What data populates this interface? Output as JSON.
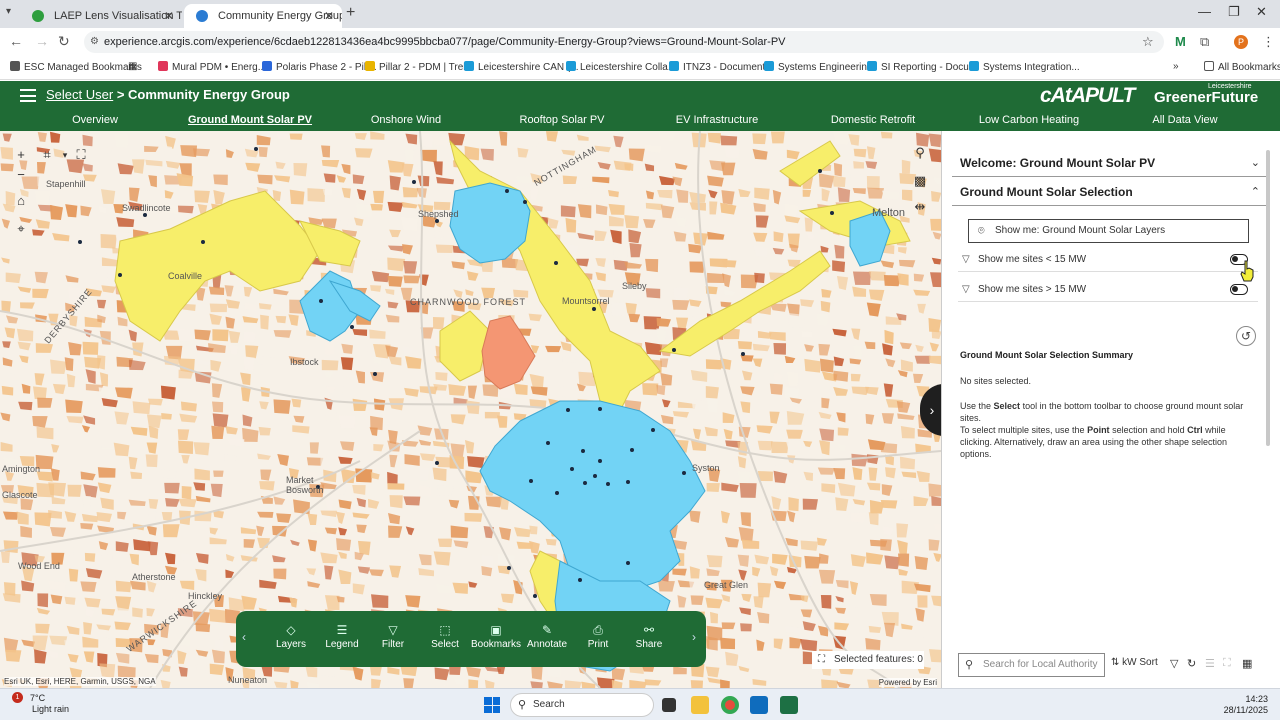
{
  "browser": {
    "tabs": [
      {
        "title": "LAEP Lens Visualisation Tool | G",
        "favicon_color": "#2e9e3e"
      },
      {
        "title": "Community Energy Group | Lei",
        "favicon_color": "#2b7cd3"
      }
    ],
    "url": "experience.arcgis.com/experience/6cdaeb122813436ea4bc9995bbcba077/page/Community-Energy-Group?views=Ground-Mount-Solar-PV",
    "bookmarks": [
      {
        "label": "ESC Managed Bookmarks",
        "color": "#555555"
      },
      {
        "label": "Mural PDM • Energ...",
        "color": "#e0365a"
      },
      {
        "label": "Polaris Phase 2 - Pill...",
        "color": "#2b67d9"
      },
      {
        "label": "Pillar 2 - PDM | Trello",
        "color": "#e8b400"
      },
      {
        "label": "Leicestershire CAN (...",
        "color": "#1b9bd7"
      },
      {
        "label": "Leicestershire Colla...",
        "color": "#1b9bd7"
      },
      {
        "label": "ITNZ3 - Documents",
        "color": "#1b9bd7"
      },
      {
        "label": "Systems Engineerin...",
        "color": "#1b9bd7"
      },
      {
        "label": "SI Reporting - Docu...",
        "color": "#1b9bd7"
      },
      {
        "label": "Systems Integration...",
        "color": "#1b9bd7"
      }
    ],
    "all_bookmarks": "All Bookmarks"
  },
  "header": {
    "select_user": "Select User",
    "separator": " > ",
    "group": "Community Energy Group",
    "logo_catapult": "cAtAPULT",
    "logo_greener": "GreenerFuture",
    "logo_greener_sub": "Leicestershire"
  },
  "nav": [
    {
      "label": "Overview",
      "active": false
    },
    {
      "label": "Ground Mount Solar PV",
      "active": true
    },
    {
      "label": "Onshore Wind",
      "active": false
    },
    {
      "label": "Rooftop Solar PV",
      "active": false
    },
    {
      "label": "EV Infrastructure",
      "active": false
    },
    {
      "label": "Domestic Retrofit",
      "active": false
    },
    {
      "label": "Low Carbon Heating",
      "active": false
    },
    {
      "label": "All Data View",
      "active": false
    }
  ],
  "map": {
    "place_labels": [
      "Swadlincote",
      "Stapenhill",
      "Ibstock",
      "Market Bosworth",
      "Amington",
      "Glascote",
      "Wood End",
      "Atherstone",
      "Nuneaton",
      "Melton",
      "Syston",
      "CHARNWOOD FOREST",
      "Mountsorrel",
      "Sileby",
      "Coalville",
      "Shepshed",
      "Hinckley",
      "Great Glen",
      "DERBYSHIRE",
      "WARWICKSHIRE",
      "NOTTINGHAM"
    ],
    "attribution_left": "Esri UK, Esri, HERE, Garmin, USGS, NGA",
    "attribution_right": "Powered by Esri",
    "selected_features": "Selected features: 0",
    "colors": {
      "base": "#f7f1e8",
      "light_orange": "#f3c48b",
      "mid_orange": "#e59a5e",
      "dark_orange": "#c8623a",
      "yellow": "#f7ee6a",
      "blue": "#72d3f5",
      "salmon": "#f49673"
    }
  },
  "toolbar": [
    {
      "label": "Layers",
      "icon": "layers-icon"
    },
    {
      "label": "Legend",
      "icon": "legend-icon"
    },
    {
      "label": "Filter",
      "icon": "filter-icon"
    },
    {
      "label": "Select",
      "icon": "select-icon"
    },
    {
      "label": "Bookmarks",
      "icon": "bookmark-icon"
    },
    {
      "label": "Annotate",
      "icon": "annotate-icon"
    },
    {
      "label": "Print",
      "icon": "print-icon"
    },
    {
      "label": "Share",
      "icon": "share-icon"
    }
  ],
  "panel": {
    "welcome": "Welcome: Ground Mount Solar PV",
    "selection": "Ground Mount Solar Selection",
    "show_layers": "Show me: Ground Mount Solar Layers",
    "filters": [
      {
        "label": "Show me sites < 15 MW",
        "enabled": true
      },
      {
        "label": "Show me sites > 15 MW",
        "enabled": true
      }
    ],
    "summary_title": "Ground Mount Solar Selection Summary",
    "no_sites": "No sites selected.",
    "instruction_1_pre": "Use the ",
    "instruction_1_bold": "Select",
    "instruction_1_post": " tool in the bottom toolbar to choose ground mount solar sites.",
    "instruction_2_pre": "To select multiple sites, use the ",
    "instruction_2_bold1": "Point",
    "instruction_2_mid": " selection and hold ",
    "instruction_2_bold2": "Ctrl",
    "instruction_2_post": " while clicking. Alternatively, draw an area using the other shape selection options.",
    "search_placeholder": "Search for Local Authority",
    "sort_label": "kW Sort"
  },
  "taskbar": {
    "temp": "7°C",
    "weather": "Light rain",
    "weather_badge": "1",
    "search": "Search",
    "time": "14:23",
    "date": "28/11/2025"
  }
}
